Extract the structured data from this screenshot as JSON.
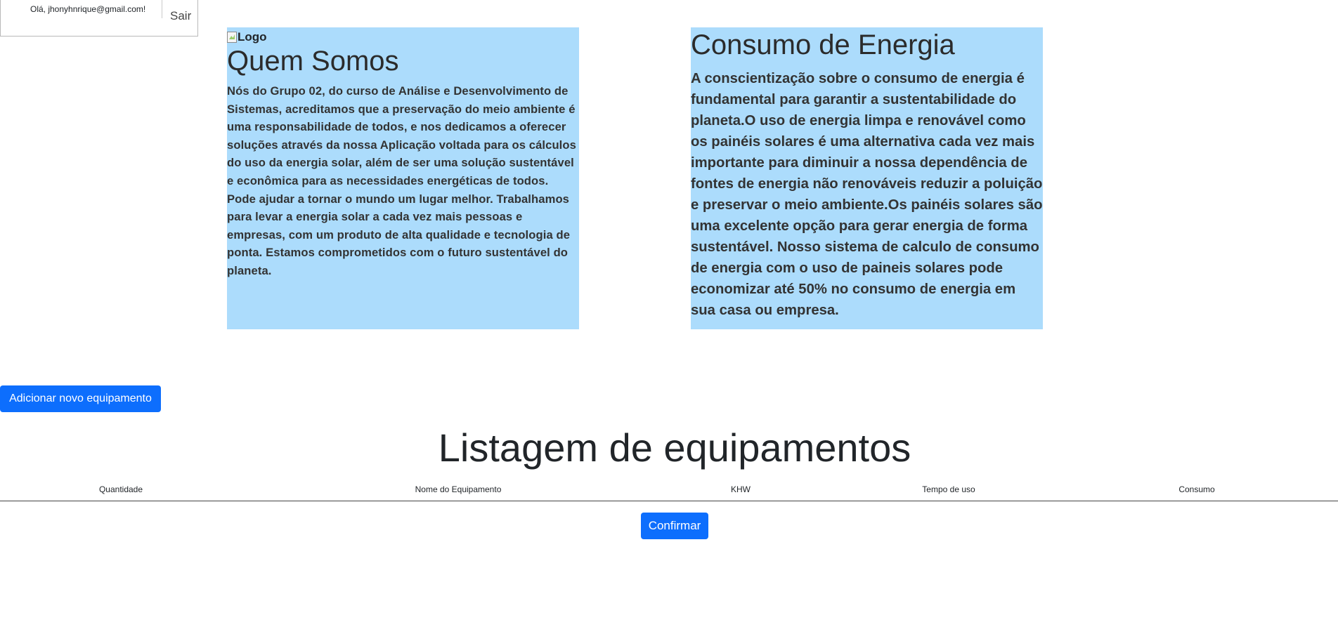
{
  "user": {
    "greeting": "Olá, jhonyhnrique@gmail.com!",
    "logout_label": "Sair"
  },
  "about": {
    "logo_alt": "Logo",
    "title": "Quem Somos",
    "text": "Nós do Grupo 02, do curso de Análise e Desenvolvimento de Sistemas, acreditamos que a preservação do meio ambiente é uma responsabilidade de todos, e nos dedicamos a oferecer soluções através da nossa Aplicação voltada para os cálculos do uso da energia solar, além de ser uma solução sustentável e econômica para as necessidades energéticas de todos. Pode ajudar a tornar o mundo um lugar melhor. Trabalhamos para levar a energia solar a cada vez mais pessoas e empresas, com um produto de alta qualidade e tecnologia de ponta. Estamos comprometidos com o futuro sustentável do planeta."
  },
  "energy": {
    "title": "Consumo de Energia",
    "text": "A conscientização sobre o consumo de energia é fundamental para garantir a sustentabilidade do planeta.O uso de energia limpa e renovável como os painéis solares é uma alternativa cada vez mais importante para diminuir a nossa dependência de fontes de energia não renováveis reduzir a poluição e preservar o meio ambiente.Os painéis solares são uma excelente opção para gerar energia de forma sustentável. Nosso sistema de calculo de consumo de energia com o uso de paineis solares pode economizar até 50% no consumo de energia em sua casa ou empresa."
  },
  "equipment": {
    "add_label": "Adicionar novo equipamento",
    "list_title": "Listagem de equipamentos",
    "columns": [
      "Quantidade",
      "Nome do Equipamento",
      "KHW",
      "Tempo de uso",
      "Consumo"
    ],
    "confirm_label": "Confirmar"
  },
  "colors": {
    "panel_bg": "#acdcfc",
    "primary": "#0d6efd"
  },
  "icons": {
    "logo": "broken-image-icon"
  }
}
